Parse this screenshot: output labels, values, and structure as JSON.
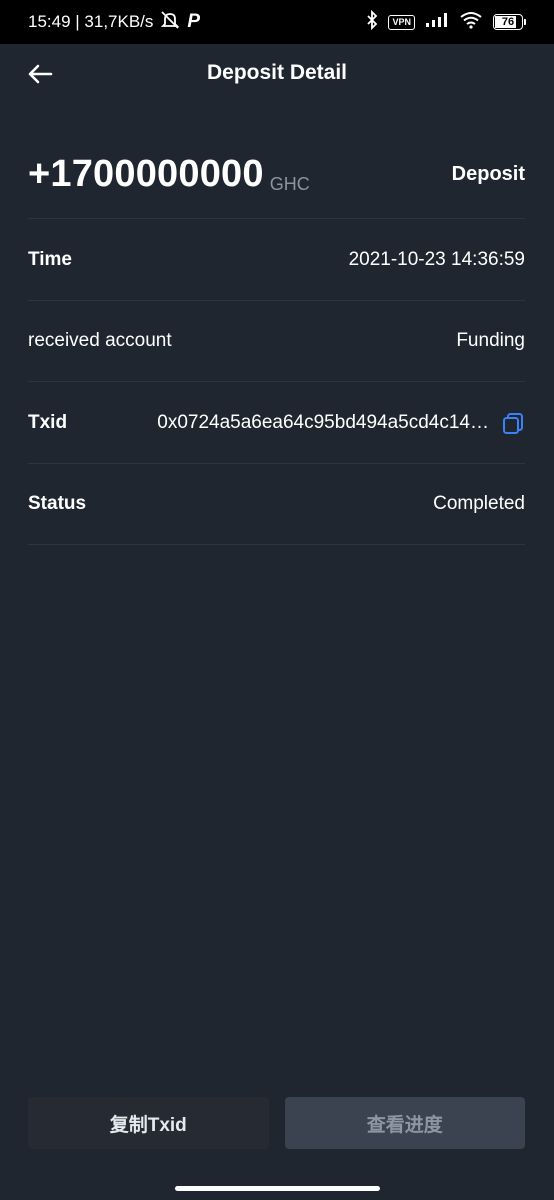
{
  "status_bar": {
    "time_speed": "15:49 | 31,7KB/s",
    "app_glyph": "P",
    "vpn": "VPN",
    "battery": "76",
    "battery_level": 0.76
  },
  "nav": {
    "title": "Deposit Detail",
    "back_icon": "arrow-left-icon"
  },
  "summary": {
    "amount": "+1700000000",
    "currency": "GHC",
    "type": "Deposit"
  },
  "details": {
    "time_label": "Time",
    "time_value": "2021-10-23 14:36:59",
    "account_label": "received account",
    "account_value": "Funding",
    "txid_label": "Txid",
    "txid_value": "0x0724a5a6ea64c95bd494a5cd4c14…",
    "status_label": "Status",
    "status_value": "Completed"
  },
  "actions": {
    "copy_label": "复制Txid",
    "progress_label": "查看进度"
  },
  "colors": {
    "background": "#1f2630",
    "accent": "#3b82f6",
    "divider": "#2c3440"
  }
}
